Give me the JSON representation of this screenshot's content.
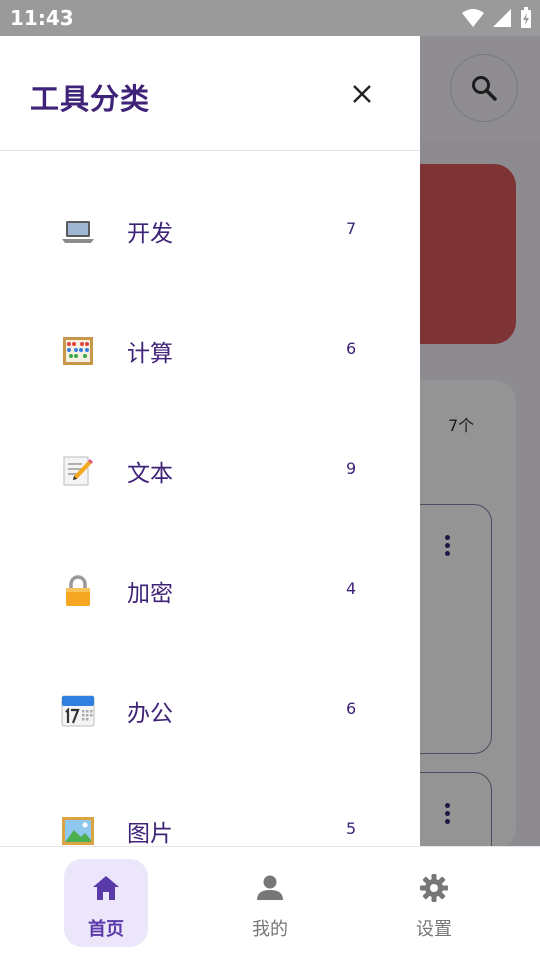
{
  "status_bar": {
    "time": "11:43"
  },
  "background": {
    "count_label": "7个"
  },
  "drawer": {
    "title": "工具分类",
    "categories": [
      {
        "icon": "laptop-icon",
        "label": "开发",
        "count": "7"
      },
      {
        "icon": "abacus-icon",
        "label": "计算",
        "count": "6"
      },
      {
        "icon": "memo-icon",
        "label": "文本",
        "count": "9"
      },
      {
        "icon": "lock-icon",
        "label": "加密",
        "count": "4"
      },
      {
        "icon": "calendar-icon",
        "label": "办公",
        "count": "6"
      },
      {
        "icon": "picture-icon",
        "label": "图片",
        "count": "5"
      }
    ]
  },
  "bottom_nav": {
    "items": [
      {
        "icon": "home-icon",
        "label": "首页",
        "active": true
      },
      {
        "icon": "person-icon",
        "label": "我的",
        "active": false
      },
      {
        "icon": "settings-icon",
        "label": "设置",
        "active": false
      }
    ]
  },
  "colors": {
    "accent": "#3f2378",
    "nav_active_bg": "#ece6fb",
    "banner": "#d95b5b"
  }
}
